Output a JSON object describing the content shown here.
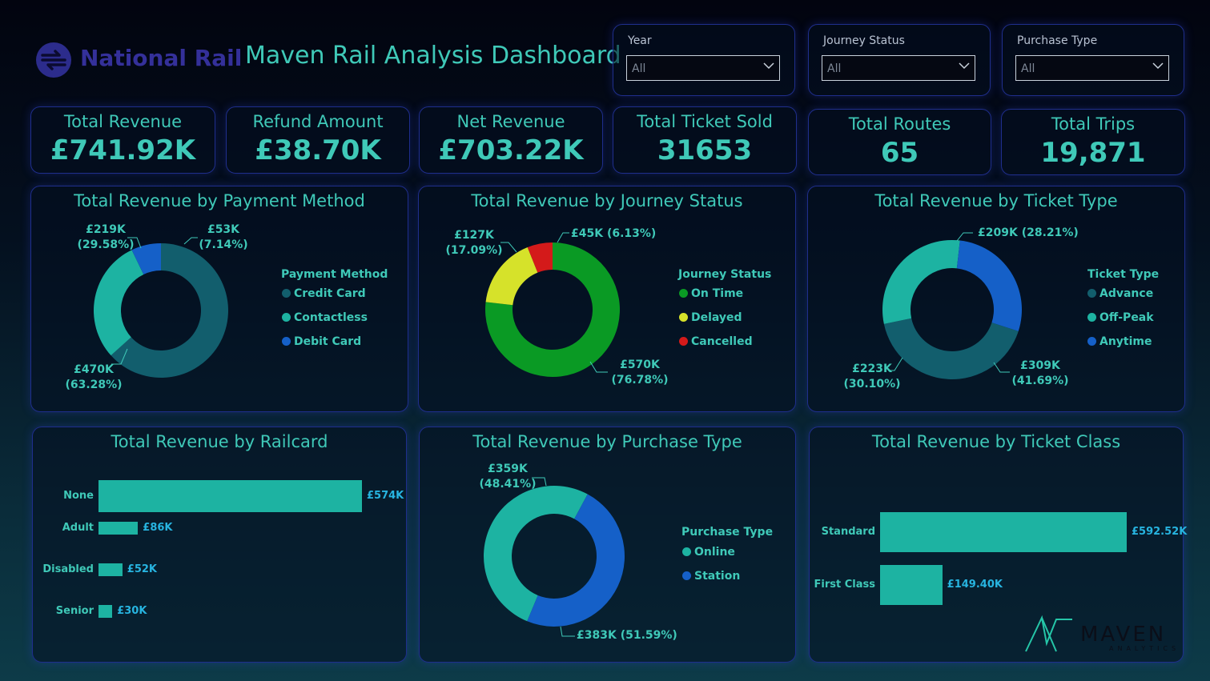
{
  "header": {
    "logo_text": "National Rail",
    "title": "Maven Rail Analysis Dashboard"
  },
  "filters": [
    {
      "label": "Year",
      "value": "All"
    },
    {
      "label": "Journey Status",
      "value": "All"
    },
    {
      "label": "Purchase Type",
      "value": "All"
    }
  ],
  "kpis": [
    {
      "label": "Total Revenue",
      "value": "£741.92K"
    },
    {
      "label": "Refund Amount",
      "value": "£38.70K"
    },
    {
      "label": "Net Revenue",
      "value": "£703.22K"
    },
    {
      "label": "Total Ticket Sold",
      "value": "31653"
    },
    {
      "label": "Total Routes",
      "value": "65"
    },
    {
      "label": "Total Trips",
      "value": "19,871"
    }
  ],
  "brand": {
    "name": "MAVEN",
    "sub": "ANALYTICS"
  },
  "colors": {
    "accent": "#3fc9b8",
    "panel_border": "#1f2e8c",
    "dark_teal": "#125e6d",
    "teal": "#1db3a2",
    "blue": "#1560c8",
    "green": "#0a9a24",
    "yellow": "#d6e22a",
    "red": "#d41a1a",
    "bar_value": "#27b4e0"
  },
  "chart_data": [
    {
      "type": "pie",
      "title": "Total Revenue by Payment Method",
      "legend_title": "Payment Method",
      "legend_position": "right",
      "categories": [
        "Credit Card",
        "Contactless",
        "Debit Card"
      ],
      "values": [
        470,
        219,
        53
      ],
      "colors": [
        "#125e6d",
        "#1db3a2",
        "#1560c8"
      ],
      "labels": [
        [
          "£470K",
          "(63.28%)"
        ],
        [
          "£219K",
          "(29.58%)"
        ],
        [
          "£53K",
          "(7.14%)"
        ]
      ]
    },
    {
      "type": "pie",
      "title": "Total Revenue by Journey Status",
      "legend_title": "Journey Status",
      "legend_position": "right",
      "categories": [
        "On Time",
        "Delayed",
        "Cancelled"
      ],
      "values": [
        570,
        127,
        45
      ],
      "colors": [
        "#0a9a24",
        "#d6e22a",
        "#d41a1a"
      ],
      "labels": [
        [
          "£570K",
          "(76.78%)"
        ],
        [
          "£127K",
          "(17.09%)"
        ],
        [
          "£45K (6.13%)"
        ]
      ]
    },
    {
      "type": "pie",
      "title": "Total Revenue by Ticket Type",
      "legend_title": "Ticket Type",
      "legend_position": "right",
      "categories": [
        "Advance",
        "Off-Peak",
        "Anytime"
      ],
      "values": [
        309,
        223,
        209
      ],
      "colors": [
        "#125e6d",
        "#1db3a2",
        "#1560c8"
      ],
      "labels": [
        [
          "£309K",
          "(41.69%)"
        ],
        [
          "£223K",
          "(30.10%)"
        ],
        [
          "£209K (28.21%)"
        ]
      ]
    },
    {
      "type": "bar",
      "orientation": "horizontal",
      "title": "Total Revenue by Railcard",
      "categories": [
        "None",
        "Adult",
        "Disabled",
        "Senior"
      ],
      "values": [
        574,
        86,
        52,
        30
      ],
      "value_labels": [
        "£574K",
        "£86K",
        "£52K",
        "£30K"
      ],
      "color": "#1db3a2"
    },
    {
      "type": "pie",
      "title": "Total Revenue by Purchase Type",
      "legend_title": "Purchase Type",
      "legend_position": "right",
      "categories": [
        "Online",
        "Station"
      ],
      "values": [
        383,
        359
      ],
      "colors": [
        "#1db3a2",
        "#1560c8"
      ],
      "labels": [
        [
          "£383K (51.59%)"
        ],
        [
          "£359K",
          "(48.41%)"
        ]
      ]
    },
    {
      "type": "bar",
      "orientation": "horizontal",
      "title": "Total Revenue by Ticket Class",
      "categories": [
        "Standard",
        "First Class"
      ],
      "values": [
        592.52,
        149.4
      ],
      "value_labels": [
        "£592.52K",
        "£149.40K"
      ],
      "color": "#1db3a2"
    }
  ]
}
